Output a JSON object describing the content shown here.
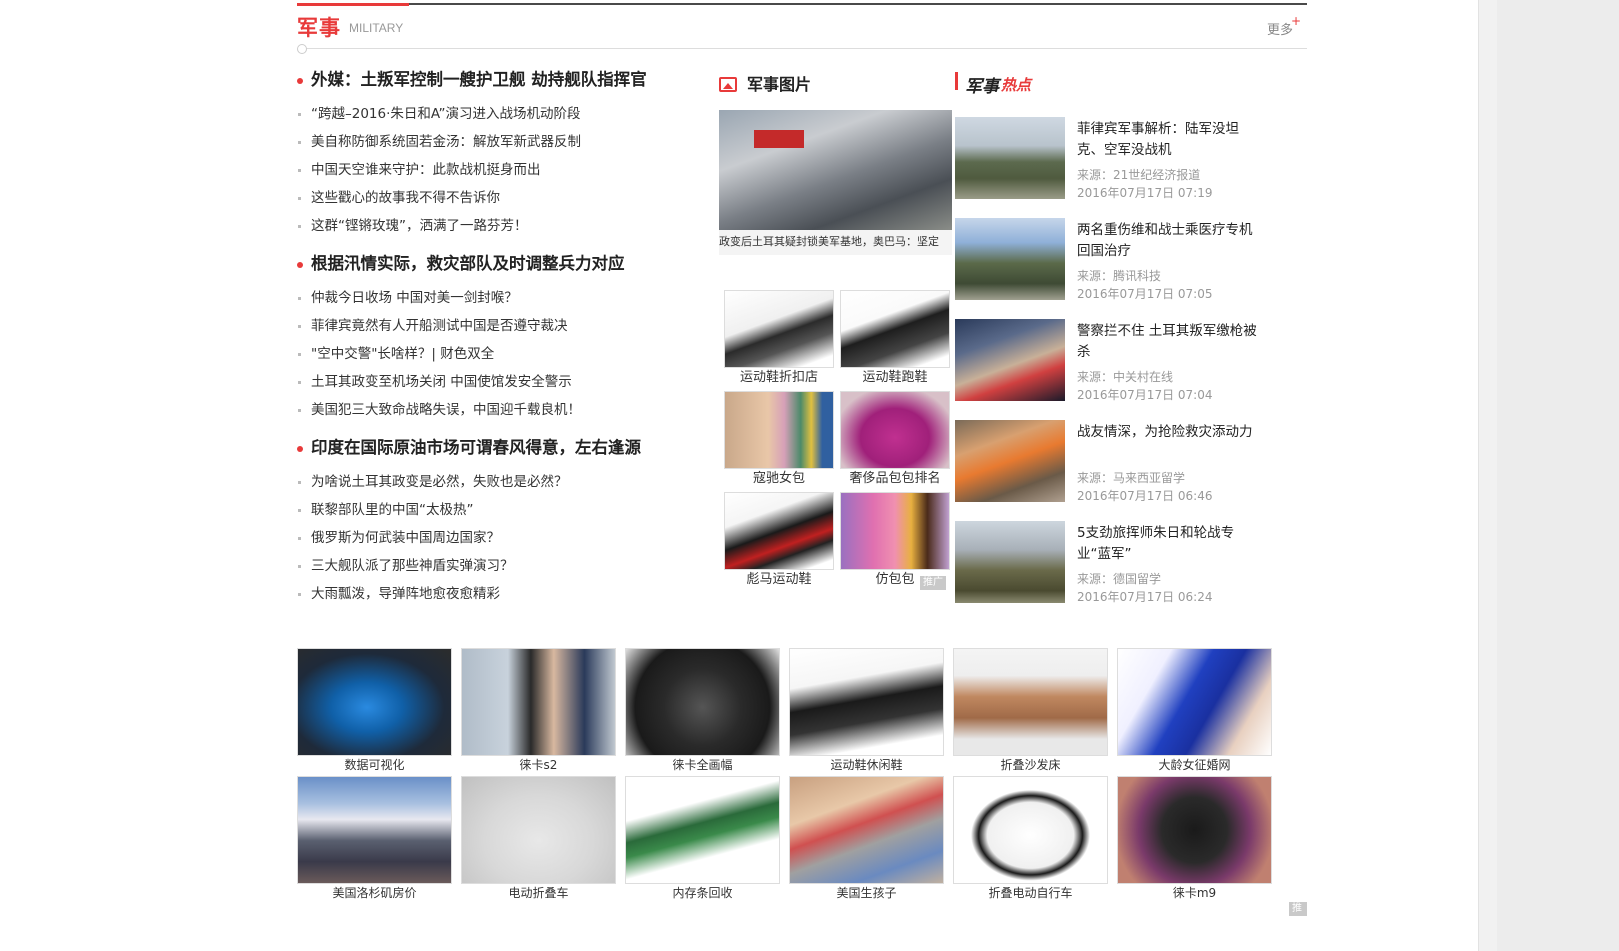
{
  "section": {
    "title": "军事",
    "subtitle": "MILITARY",
    "more_label": "更多",
    "more_plus": "+"
  },
  "news_groups": [
    {
      "headline": "外媒：土叛军控制一艘护卫舰 劫持舰队指挥官",
      "items": [
        "“跨越–2016·朱日和A”演习进入战场机动阶段",
        "美自称防御系统固若金汤：解放军新武器反制",
        "中国天空谁来守护：此款战机挺身而出",
        "这些戳心的故事我不得不告诉你",
        "这群“铿锵玫瑰”，洒满了一路芬芳！"
      ]
    },
    {
      "headline": "根据汛情实际，救灾部队及时调整兵力对应",
      "items": [
        "仲裁今日收场 中国对美一剑封喉？",
        "菲律宾竟然有人开船测试中国是否遵守裁决",
        "\"空中交警\"长啥样？| 财色双全",
        "土耳其政变至机场关闭 中国使馆发安全警示",
        "美国犯三大致命战略失误，中国迎千载良机！"
      ]
    },
    {
      "headline": "印度在国际原油市场可谓春风得意，左右逢源",
      "items": [
        "为啥说土耳其政变是必然，失败也是必然？",
        "联黎部队里的中国“太极热”",
        "俄罗斯为何武装中国周边国家？",
        "三大舰队派了那些神盾实弹演习？",
        "大雨瓢泼，导弹阵地愈夜愈精彩"
      ]
    }
  ],
  "pictures": {
    "title": "军事图片",
    "big_caption": "政变后土耳其疑封锁美军基地，奥巴马：坚定",
    "ads": [
      "运动鞋折扣店",
      "运动鞋跑鞋",
      "寇驰女包",
      "奢侈品包包排名",
      "彪马运动鞋",
      "仿包包"
    ],
    "ad_tag": "推广"
  },
  "hot": {
    "title_a": "军事",
    "title_b": "热点",
    "items": [
      {
        "title": "菲律宾军事解析：陆军没坦克、空军没战机",
        "source": "来源：21世纪经济报道",
        "time": "2016年07月17日 07:19"
      },
      {
        "title": "两名重伤维和战士乘医疗专机回国治疗",
        "source": "来源：腾讯科技",
        "time": "2016年07月17日 07:05"
      },
      {
        "title": "警察拦不住 土耳其叛军缴枪被杀",
        "source": "来源：中关村在线",
        "time": "2016年07月17日 07:04"
      },
      {
        "title": "战友情深，为抢险救灾添动力",
        "source": "来源：马来西亚留学",
        "time": "2016年07月17日 06:46"
      },
      {
        "title": "5支劲旅挥师朱日和轮战专业“蓝军”",
        "source": "来源：德国留学",
        "time": "2016年07月17日 06:24"
      }
    ]
  },
  "bottom": {
    "row1": [
      "数据可视化",
      "徕卡s2",
      "徕卡全画幅",
      "运动鞋休闲鞋",
      "折叠沙发床",
      "大龄女征婚网"
    ],
    "row2": [
      "美国洛杉矶房价",
      "电动折叠车",
      "内存条回收",
      "美国生孩子",
      "折叠电动自行车",
      "徕卡m9"
    ],
    "ad_tag": "推广"
  }
}
